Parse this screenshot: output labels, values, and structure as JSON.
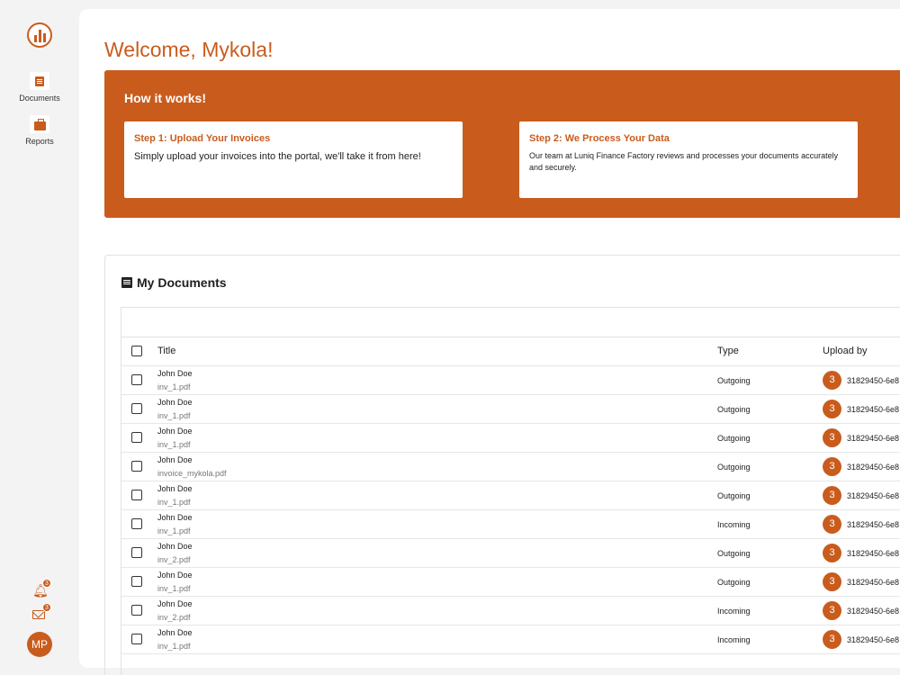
{
  "nav": {
    "documents_label": "Documents",
    "reports_label": "Reports",
    "notifications_count": "3",
    "messages_count": "3",
    "user_initials": "MP"
  },
  "welcome": "Welcome, Mykola!",
  "banner": {
    "title": "How it works!",
    "steps": [
      {
        "title": "Step 1: Upload Your Invoices",
        "desc": "Simply upload your invoices into the portal, we'll take it from here!"
      },
      {
        "title": "Step 2: We Process Your Data",
        "desc": "Our team at Luniq Finance Factory reviews and processes your documents accurately and securely."
      }
    ]
  },
  "documents": {
    "title": "My Documents",
    "columns": {
      "title": "Title",
      "type": "Type",
      "upload_by": "Upload by"
    },
    "rows": [
      {
        "name": "John Doe",
        "file": "inv_1.pdf",
        "type": "Outgoing",
        "avatar": "3",
        "uploader": "31829450-6e8"
      },
      {
        "name": "John Doe",
        "file": "inv_1.pdf",
        "type": "Outgoing",
        "avatar": "3",
        "uploader": "31829450-6e8"
      },
      {
        "name": "John Doe",
        "file": "inv_1.pdf",
        "type": "Outgoing",
        "avatar": "3",
        "uploader": "31829450-6e8"
      },
      {
        "name": "John Doe",
        "file": "invoice_mykola.pdf",
        "type": "Outgoing",
        "avatar": "3",
        "uploader": "31829450-6e8"
      },
      {
        "name": "John Doe",
        "file": "inv_1.pdf",
        "type": "Outgoing",
        "avatar": "3",
        "uploader": "31829450-6e8"
      },
      {
        "name": "John Doe",
        "file": "inv_1.pdf",
        "type": "Incoming",
        "avatar": "3",
        "uploader": "31829450-6e8"
      },
      {
        "name": "John Doe",
        "file": "inv_2.pdf",
        "type": "Outgoing",
        "avatar": "3",
        "uploader": "31829450-6e8"
      },
      {
        "name": "John Doe",
        "file": "inv_1.pdf",
        "type": "Outgoing",
        "avatar": "3",
        "uploader": "31829450-6e8"
      },
      {
        "name": "John Doe",
        "file": "inv_2.pdf",
        "type": "Incoming",
        "avatar": "3",
        "uploader": "31829450-6e8"
      },
      {
        "name": "John Doe",
        "file": "inv_1.pdf",
        "type": "Incoming",
        "avatar": "3",
        "uploader": "31829450-6e8"
      }
    ]
  }
}
